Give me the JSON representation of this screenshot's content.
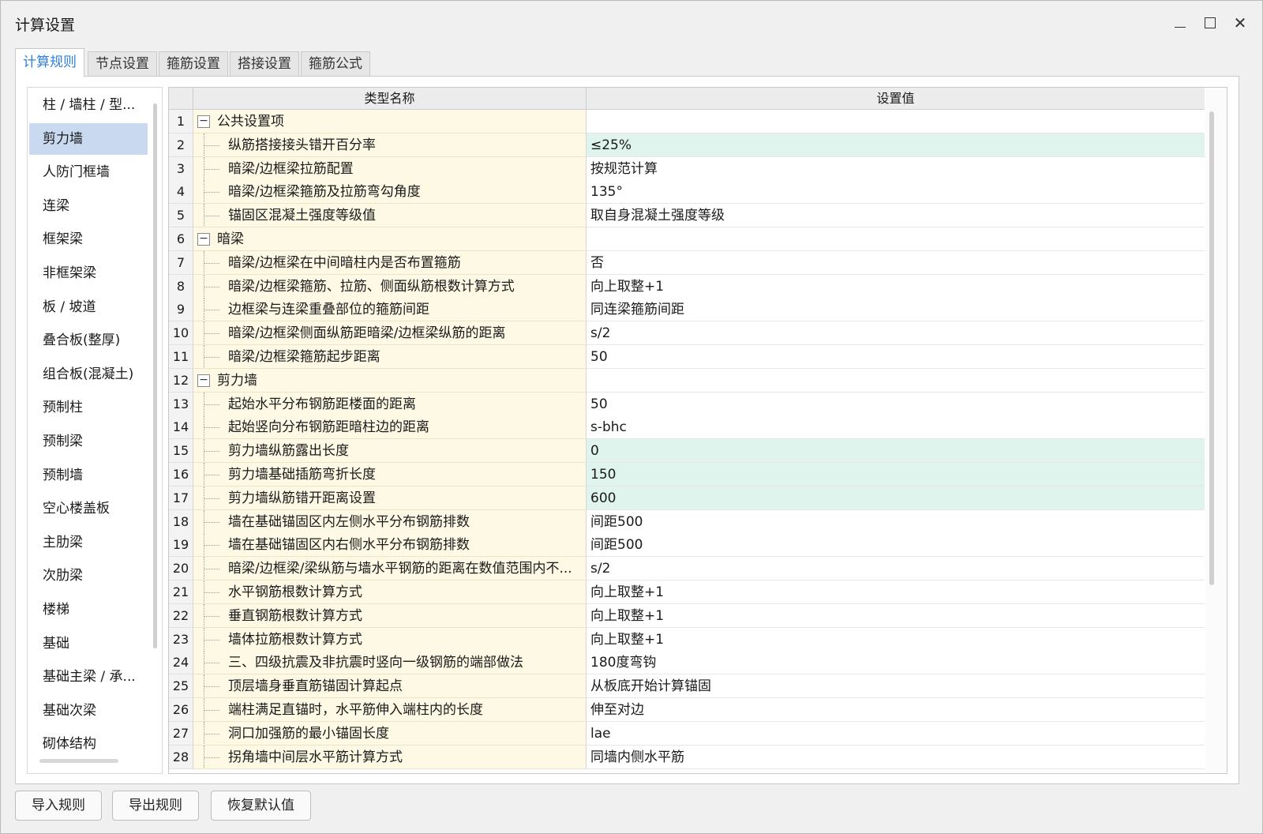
{
  "window": {
    "title": "计算设置"
  },
  "tabs": [
    {
      "label": "计算规则",
      "active": true
    },
    {
      "label": "节点设置"
    },
    {
      "label": "箍筋设置"
    },
    {
      "label": "搭接设置"
    },
    {
      "label": "箍筋公式"
    }
  ],
  "left_list": {
    "selected": "剪力墙",
    "items": [
      "柱 / 墙柱 / 型...",
      "剪力墙",
      "人防门框墙",
      "连梁",
      "框架梁",
      "非框架梁",
      "板 / 坡道",
      "叠合板(整厚)",
      "组合板(混凝土)",
      "预制柱",
      "预制梁",
      "预制墙",
      "空心楼盖板",
      "主肋梁",
      "次肋梁",
      "楼梯",
      "基础",
      "基础主梁 / 承...",
      "基础次梁",
      "砌体结构"
    ]
  },
  "grid": {
    "columns": {
      "name": "类型名称",
      "value": "设置值"
    },
    "rows": [
      {
        "n": "1",
        "name": "公共设置项",
        "value": "",
        "group": true
      },
      {
        "n": "2",
        "name": "纵筋搭接接头错开百分率",
        "value": "≤25%",
        "highlight": true
      },
      {
        "n": "3",
        "name": "暗梁/边框梁拉筋配置",
        "value": "按规范计算"
      },
      {
        "n": "4",
        "name": "暗梁/边框梁箍筋及拉筋弯勾角度",
        "value": "135°"
      },
      {
        "n": "5",
        "name": "锚固区混凝土强度等级值",
        "value": "取自身混凝土强度等级"
      },
      {
        "n": "6",
        "name": "暗梁",
        "value": "",
        "group": true
      },
      {
        "n": "7",
        "name": "暗梁/边框梁在中间暗柱内是否布置箍筋",
        "value": "否"
      },
      {
        "n": "8",
        "name": "暗梁/边框梁箍筋、拉筋、侧面纵筋根数计算方式",
        "value": "向上取整+1"
      },
      {
        "n": "9",
        "name": "边框梁与连梁重叠部位的箍筋间距",
        "value": "同连梁箍筋间距"
      },
      {
        "n": "10",
        "name": "暗梁/边框梁侧面纵筋距暗梁/边框梁纵筋的距离",
        "value": "s/2"
      },
      {
        "n": "11",
        "name": "暗梁/边框梁箍筋起步距离",
        "value": "50"
      },
      {
        "n": "12",
        "name": "剪力墙",
        "value": "",
        "group": true
      },
      {
        "n": "13",
        "name": "起始水平分布钢筋距楼面的距离",
        "value": "50"
      },
      {
        "n": "14",
        "name": "起始竖向分布钢筋距暗柱边的距离",
        "value": "s-bhc"
      },
      {
        "n": "15",
        "name": "剪力墙纵筋露出长度",
        "value": "0",
        "highlight": true
      },
      {
        "n": "16",
        "name": "剪力墙基础插筋弯折长度",
        "value": "150",
        "highlight": true
      },
      {
        "n": "17",
        "name": "剪力墙纵筋错开距离设置",
        "value": "600",
        "highlight": true
      },
      {
        "n": "18",
        "name": "墙在基础锚固区内左侧水平分布钢筋排数",
        "value": "间距500"
      },
      {
        "n": "19",
        "name": "墙在基础锚固区内右侧水平分布钢筋排数",
        "value": "间距500"
      },
      {
        "n": "20",
        "name": "暗梁/边框梁/梁纵筋与墙水平钢筋的距离在数值范围内不...",
        "value": "s/2"
      },
      {
        "n": "21",
        "name": "水平钢筋根数计算方式",
        "value": "向上取整+1"
      },
      {
        "n": "22",
        "name": "垂直钢筋根数计算方式",
        "value": "向上取整+1"
      },
      {
        "n": "23",
        "name": "墙体拉筋根数计算方式",
        "value": "向上取整+1"
      },
      {
        "n": "24",
        "name": "三、四级抗震及非抗震时竖向一级钢筋的端部做法",
        "value": "180度弯钩"
      },
      {
        "n": "25",
        "name": "顶层墙身垂直筋锚固计算起点",
        "value": "从板底开始计算锚固"
      },
      {
        "n": "26",
        "name": "端柱满足直锚时，水平筋伸入端柱内的长度",
        "value": "伸至对边"
      },
      {
        "n": "27",
        "name": "洞口加强筋的最小锚固长度",
        "value": "lae"
      },
      {
        "n": "28",
        "name": "拐角墙中间层水平筋计算方式",
        "value": "同墙内侧水平筋"
      }
    ]
  },
  "buttons": {
    "import": "导入规则",
    "export": "导出规则",
    "restore": "恢复默认值"
  },
  "colors": {
    "accent": "#2f7fd8",
    "selected_item": "#c8d9f0",
    "name_cell": "#fdf9e4",
    "highlight_value": "#dff4ec"
  }
}
